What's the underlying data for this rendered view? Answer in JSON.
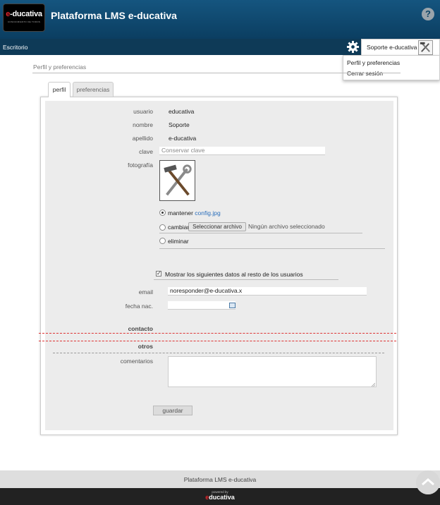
{
  "header": {
    "logo_brand": "e-ducativa",
    "logo_tagline": "CONOCIMIENTO DE TODOS",
    "title": "Plataforma LMS e-ducativa",
    "help_label": "?"
  },
  "navbar": {
    "desk_label": "Escritorio",
    "user_name": "Soporte e-ducativa"
  },
  "user_menu": {
    "items": [
      {
        "label": "Perfil y preferencias"
      },
      {
        "label": "Cerrar sesión"
      }
    ]
  },
  "breadcrumb": "Perfil y preferencias",
  "tabs": [
    {
      "label": "perfil",
      "active": true
    },
    {
      "label": "preferencias",
      "active": false
    }
  ],
  "form": {
    "usuario_label": "usuario",
    "usuario_value": "educativa",
    "nombre_label": "nombre",
    "nombre_value": "Soporte",
    "apellido_label": "apellido",
    "apellido_value": "e-ducativa",
    "clave_label": "clave",
    "clave_placeholder": "Conservar clave",
    "foto_label": "fotografía",
    "foto_options": {
      "keep_label": "mantener",
      "keep_file": "config.jpg",
      "change_label": "cambiar",
      "file_button": "Seleccionar archivo",
      "no_file": "Ningún archivo seleccionado",
      "delete_label": "eliminar",
      "selected": "mantener"
    },
    "show_data_label": "Mostrar los siguientes datos al resto de los usuarios",
    "show_data_checked": true,
    "email_label": "email",
    "email_value": "noresponder@e-ducativa.x",
    "fecha_label": "fecha nac.",
    "fecha_value": "",
    "contacto_label": "contacto",
    "otros_label": "otros",
    "comentarios_label": "comentarios",
    "comentarios_value": "",
    "save_label": "guardar"
  },
  "footer": {
    "text": "Plataforma LMS e-ducativa",
    "powered_sub": "powered by",
    "powered_brand": "educativa"
  },
  "colors": {
    "header_bg": "#0b3e61",
    "navbar_bg": "#0e3a57",
    "accent_red": "#e5242a",
    "link": "#2a6ebb",
    "panel_bg": "#ececec"
  }
}
